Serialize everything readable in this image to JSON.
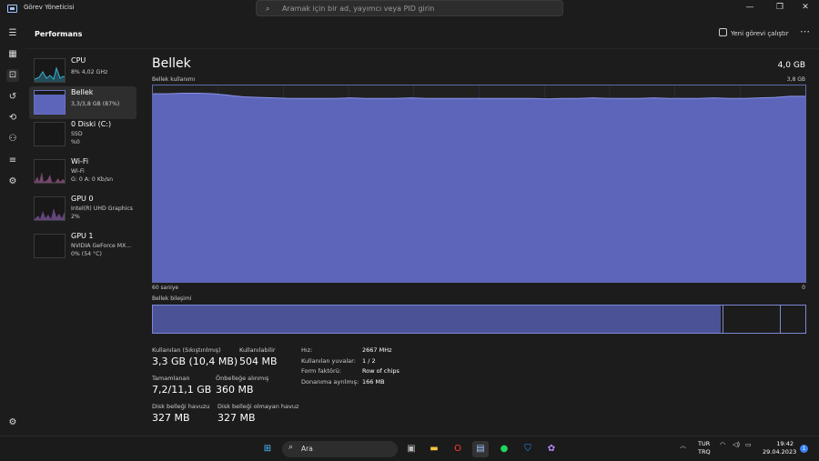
{
  "window": {
    "title": "Görev Yöneticisi"
  },
  "search": {
    "placeholder": "Aramak için bir ad, yayımcı veya PID girin"
  },
  "header": {
    "page_title": "Performans",
    "run_task_label": "Yeni görevi çalıştır",
    "more_label": "⋯"
  },
  "sidebar": {
    "items": [
      {
        "title": "CPU",
        "sub1": "8% 4,02 GHz",
        "sub2": "",
        "sub3": ""
      },
      {
        "title": "Bellek",
        "sub1": "3,3/3,8 GB (87%)",
        "sub2": "",
        "sub3": ""
      },
      {
        "title": "0 Diski (C:)",
        "sub1": "SSD",
        "sub2": "%0",
        "sub3": ""
      },
      {
        "title": "Wi-Fi",
        "sub1": "Wi-Fi",
        "sub2": "G: 0 A: 0 Kb/sn",
        "sub3": ""
      },
      {
        "title": "GPU 0",
        "sub1": "Intel(R) UHD Graphics",
        "sub2": "2%",
        "sub3": ""
      },
      {
        "title": "GPU 1",
        "sub1": "NVIDIA GeForce MX...",
        "sub2": "0% (54 °C)",
        "sub3": ""
      }
    ]
  },
  "memory": {
    "title": "Bellek",
    "total": "4,0 GB",
    "usage_label": "Bellek kullanımı",
    "usage_max": "3,8 GB",
    "axis_left": "60 saniye",
    "axis_right": "0",
    "composition_label": "Bellek bileşimi",
    "composition_used_fraction": 0.87,
    "usage_history_gb": [
      3.64,
      3.64,
      3.65,
      3.65,
      3.64,
      3.61,
      3.58,
      3.57,
      3.56,
      3.55,
      3.55,
      3.55,
      3.55,
      3.56,
      3.55,
      3.55,
      3.55,
      3.56,
      3.55,
      3.55,
      3.55,
      3.55,
      3.55,
      3.55,
      3.55,
      3.55,
      3.54,
      3.55,
      3.55,
      3.56,
      3.55,
      3.55,
      3.55,
      3.56,
      3.55,
      3.55,
      3.55,
      3.56,
      3.55,
      3.55,
      3.56,
      3.57,
      3.59,
      3.59
    ]
  },
  "stats": {
    "in_use_label": "Kullanılan (Sıkıştırılmış)",
    "in_use_value": "3,3 GB (10,4 MB)",
    "available_label": "Kullanılabilir",
    "available_value": "504 MB",
    "committed_label": "Tamamlanan",
    "committed_value": "7,2/11,1 GB",
    "cached_label": "Önbelleğe alınmış",
    "cached_value": "360 MB",
    "paged_label": "Disk belleği havuzu",
    "paged_value": "327 MB",
    "nonpaged_label": "Disk belleği olmayan havuz",
    "nonpaged_value": "327 MB"
  },
  "properties": {
    "speed_label": "Hız:",
    "speed_value": "2667 MHz",
    "slots_label": "Kullanılan yuvalar:",
    "slots_value": "1 / 2",
    "form_label": "Form faktörü:",
    "form_value": "Row of chips",
    "reserved_label": "Donanıma ayrılmış:",
    "reserved_value": "166 MB"
  },
  "taskbar": {
    "search_label": "Ara",
    "lang_top": "TUR",
    "lang_bottom": "TRQ",
    "time": "19:42",
    "date": "29.04.2023",
    "notification_count": "1"
  },
  "colors": {
    "accent": "#6871c9",
    "graph_border": "#5f6aa8",
    "cpu": "#38b2d0",
    "wifi": "#c26bb0",
    "gpu": "#a36bd0"
  }
}
